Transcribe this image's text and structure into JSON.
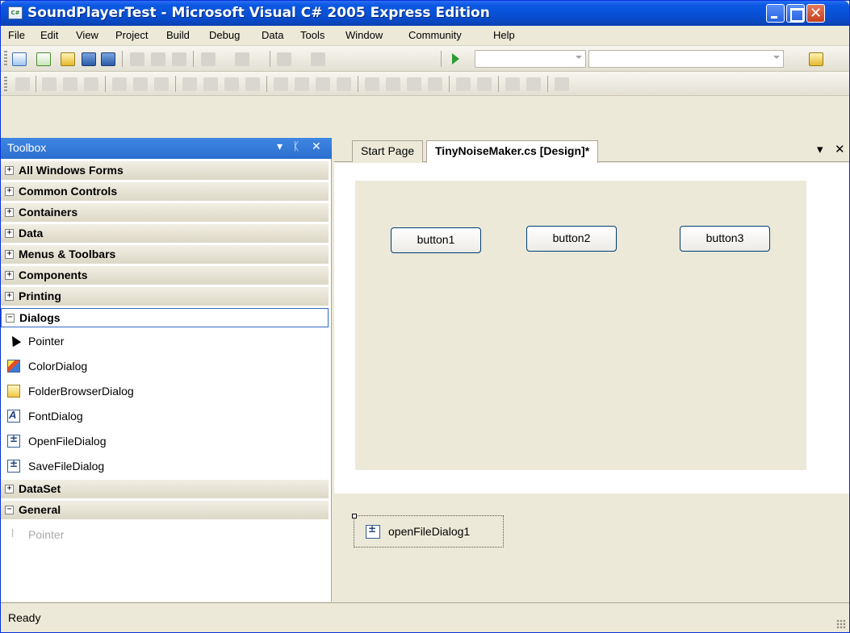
{
  "window": {
    "title": "SoundPlayerTest - Microsoft Visual C# 2005 Express Edition",
    "close_glyph": "✕",
    "app_icon_text": "C#"
  },
  "menu": [
    "File",
    "Edit",
    "View",
    "Project",
    "Build",
    "Debug",
    "Data",
    "Tools",
    "Window",
    "Community",
    "Help"
  ],
  "toolbox": {
    "title": "Toolbox",
    "pin_glyph": "▾",
    "autohide_glyph": "ᛕ",
    "close_glyph": "✕",
    "categories": [
      {
        "label": "All Windows Forms",
        "state": "+"
      },
      {
        "label": "Common Controls",
        "state": "+"
      },
      {
        "label": "Containers",
        "state": "+"
      },
      {
        "label": "Data",
        "state": "+"
      },
      {
        "label": "Menus & Toolbars",
        "state": "+"
      },
      {
        "label": "Components",
        "state": "+"
      },
      {
        "label": "Printing",
        "state": "+"
      },
      {
        "label": "Dialogs",
        "state": "−"
      }
    ],
    "dialog_tools": [
      {
        "label": "Pointer",
        "icon": "pointer-icon"
      },
      {
        "label": "ColorDialog",
        "icon": "color-dialog-icon"
      },
      {
        "label": "FolderBrowserDialog",
        "icon": "folder-browser-icon"
      },
      {
        "label": "FontDialog",
        "icon": "font-dialog-icon"
      },
      {
        "label": "OpenFileDialog",
        "icon": "open-file-dialog-icon"
      },
      {
        "label": "SaveFileDialog",
        "icon": "save-file-dialog-icon"
      }
    ],
    "dataset": {
      "label": "DataSet",
      "state": "+"
    },
    "general": {
      "label": "General",
      "state": "−"
    },
    "general_tools": [
      {
        "label": "Pointer",
        "icon": "pointer-icon"
      }
    ]
  },
  "tabs": {
    "start_page": "Start Page",
    "designer": "TinyNoiseMaker.cs [Design]*",
    "menu_glyph": "▾",
    "close_glyph": "✕"
  },
  "form": {
    "buttons": [
      "button1",
      "button2",
      "button3"
    ]
  },
  "tray": {
    "component": "openFileDialog1"
  },
  "status": {
    "text": "Ready"
  }
}
